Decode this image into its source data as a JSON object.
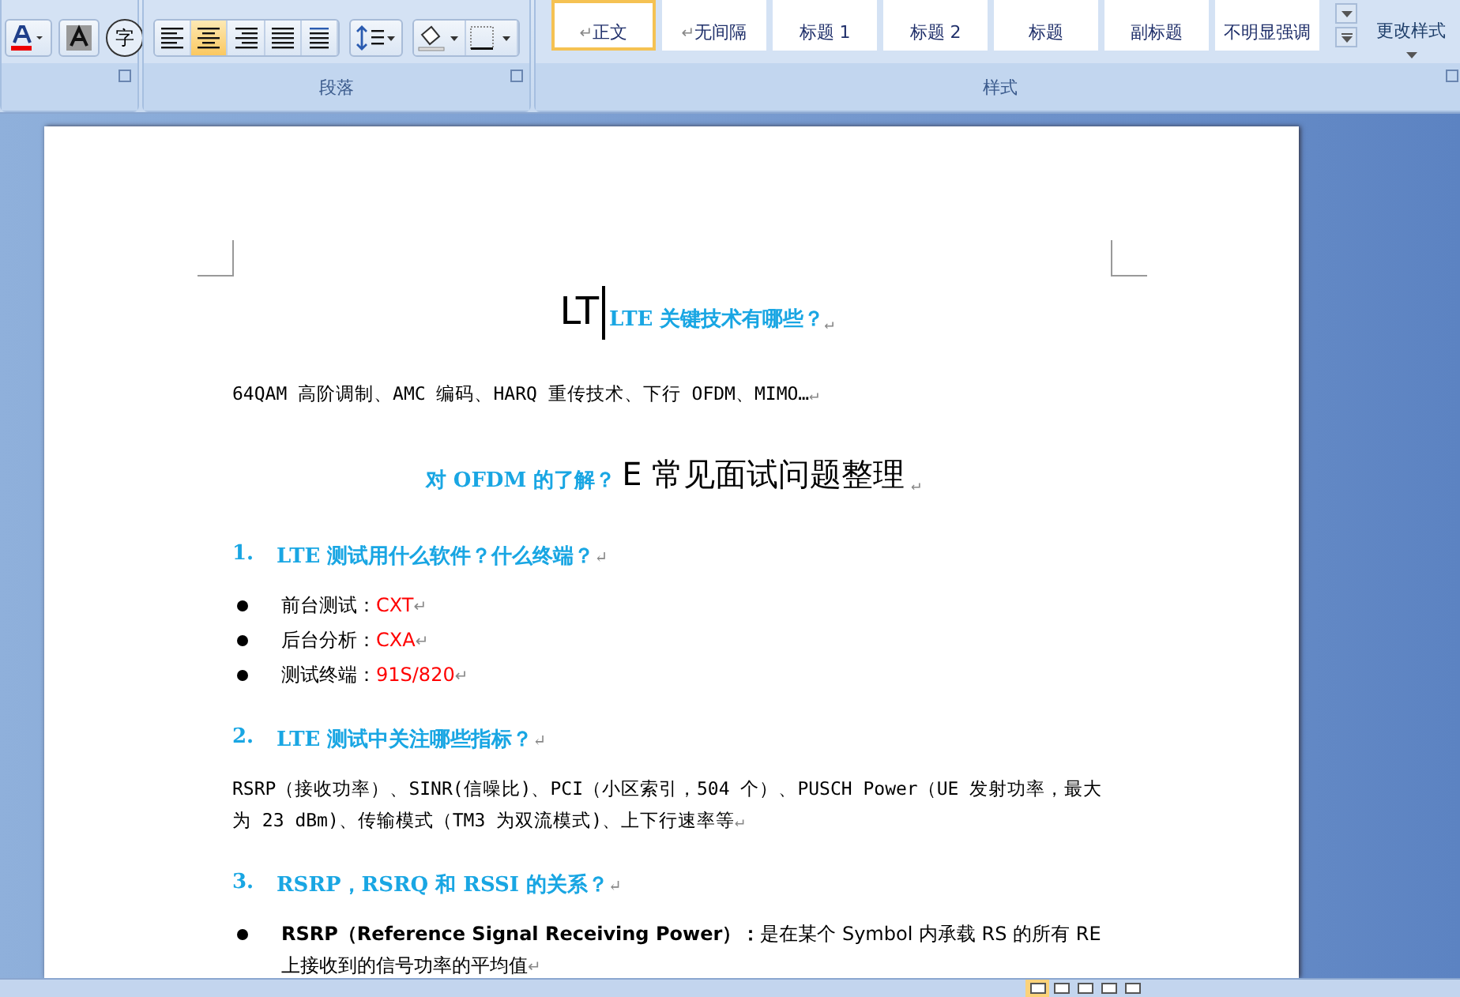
{
  "ribbon": {
    "font_group": {
      "enclosed_char": "字"
    },
    "paragraph_group": {
      "label": "段落",
      "align_buttons": [
        {
          "kind": "left",
          "selected": false
        },
        {
          "kind": "center",
          "selected": true
        },
        {
          "kind": "right",
          "selected": false
        },
        {
          "kind": "justify",
          "selected": false
        },
        {
          "kind": "distributed",
          "selected": false
        }
      ]
    },
    "styles_group": {
      "label": "样式",
      "styles": [
        {
          "label": "正文",
          "mark": "↵",
          "selected": true
        },
        {
          "label": "无间隔",
          "mark": "↵",
          "selected": false
        },
        {
          "label": "标题 1",
          "selected": false
        },
        {
          "label": "标题 2",
          "selected": false
        },
        {
          "label": "标题",
          "selected": false
        },
        {
          "label": "副标题",
          "selected": false
        },
        {
          "label": "不明显强调",
          "selected": false
        }
      ],
      "change_styles": "更改样式"
    }
  },
  "document": {
    "blocks": [
      {
        "kind": "title",
        "big": "LT",
        "text": "LTE 关键技术有哪些？",
        "mark": "↵"
      },
      {
        "kind": "paragraph",
        "text": "64QAM 高阶调制、AMC 编码、HARQ 重传技术、下行 OFDM、MIMO…",
        "mark": "↵"
      },
      {
        "kind": "title2",
        "text": "对 OFDM 的了解？",
        "big": "E 常见面试问题整理",
        "mark": "↵"
      },
      {
        "kind": "heading",
        "number": "1.",
        "text": "LTE 测试用什么软件？什么终端？",
        "mark": "↵"
      },
      {
        "kind": "bullet",
        "text": "前台测试：",
        "value": "CXT",
        "mark": "↵"
      },
      {
        "kind": "bullet",
        "text": "后台分析：",
        "value": "CXA",
        "mark": "↵"
      },
      {
        "kind": "bullet",
        "text": "测试终端：",
        "value": "91S/820",
        "mark": "↵"
      },
      {
        "kind": "heading",
        "number": "2.",
        "text": "LTE 测试中关注哪些指标？",
        "mark": "↵"
      },
      {
        "kind": "paragraph",
        "text": "RSRP（接收功率）、SINR(信噪比)、PCI（小区索引，504 个）、PUSCH Power（UE 发射功率，最大为 23 dBm)、传输模式（TM3 为双流模式)、上下行速率等",
        "mark": "↵"
      },
      {
        "kind": "heading",
        "number": "3.",
        "text": "RSRP，RSRQ 和 RSSI 的关系？",
        "mark": "↵"
      },
      {
        "kind": "bullet",
        "text": "**RSRP（Reference Signal Receiving Power）：**是在某个 Symbol 内承载 RS 的所有 RE 上接收到的信号功率的平均值",
        "mark": "↵"
      }
    ]
  }
}
